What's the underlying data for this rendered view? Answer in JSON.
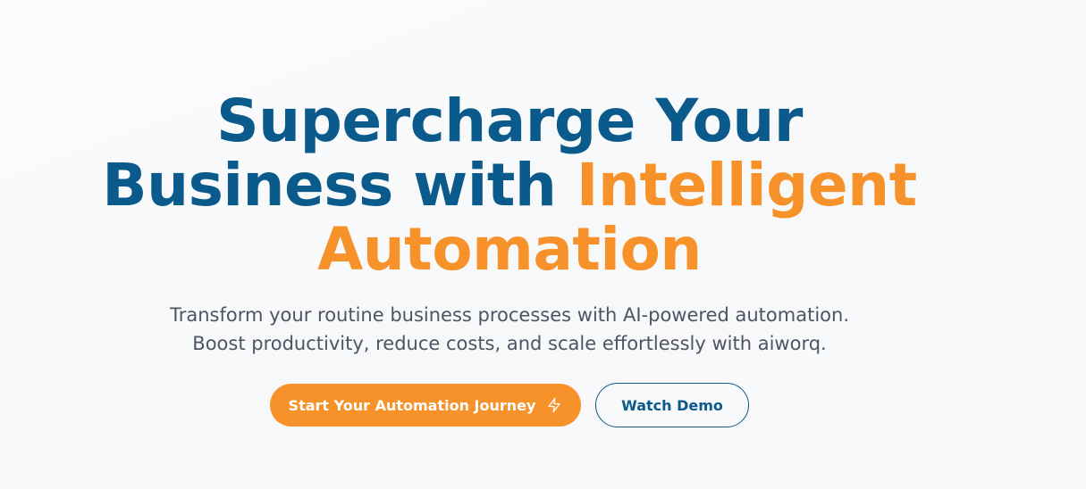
{
  "hero": {
    "headline": {
      "line1": "Supercharge Your",
      "line2_plain": "Business with ",
      "line2_accent": "Intelligent",
      "line3_accent": "Automation"
    },
    "subtitle": {
      "line1": "Transform your routine business processes with AI-powered automation.",
      "line2": "Boost productivity, reduce costs, and scale effortlessly with aiworq."
    },
    "cta": {
      "primary_label": "Start Your Automation Journey",
      "primary_icon": "bolt-icon",
      "secondary_label": "Watch Demo"
    }
  },
  "colors": {
    "brand_blue": "#0b5a8c",
    "brand_orange": "#f7922a",
    "text_gray": "#4b5563"
  }
}
